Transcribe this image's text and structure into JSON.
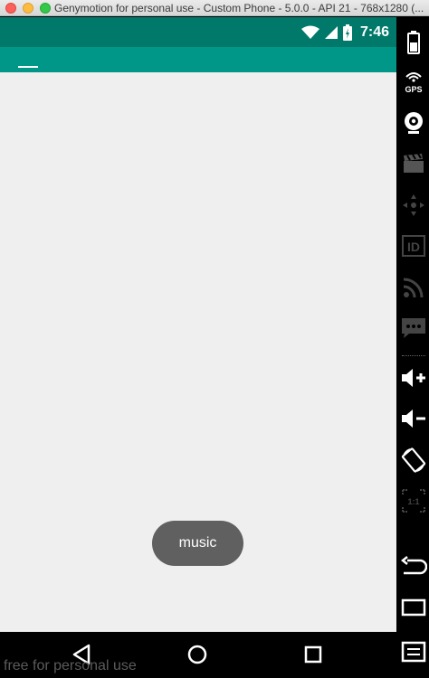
{
  "window": {
    "title": "Genymotion for personal use - Custom Phone - 5.0.0 - API 21 - 768x1280 (..."
  },
  "statusbar": {
    "time": "7:46"
  },
  "toast": {
    "text": "music"
  },
  "watermark": {
    "text": "free for personal use"
  },
  "sidebar": {
    "gps_label": "GPS",
    "id_label": "ID",
    "pixel_label": "1:1"
  },
  "colors": {
    "statusbar": "#00796b",
    "appbar": "#009688",
    "toast": "#606060"
  }
}
